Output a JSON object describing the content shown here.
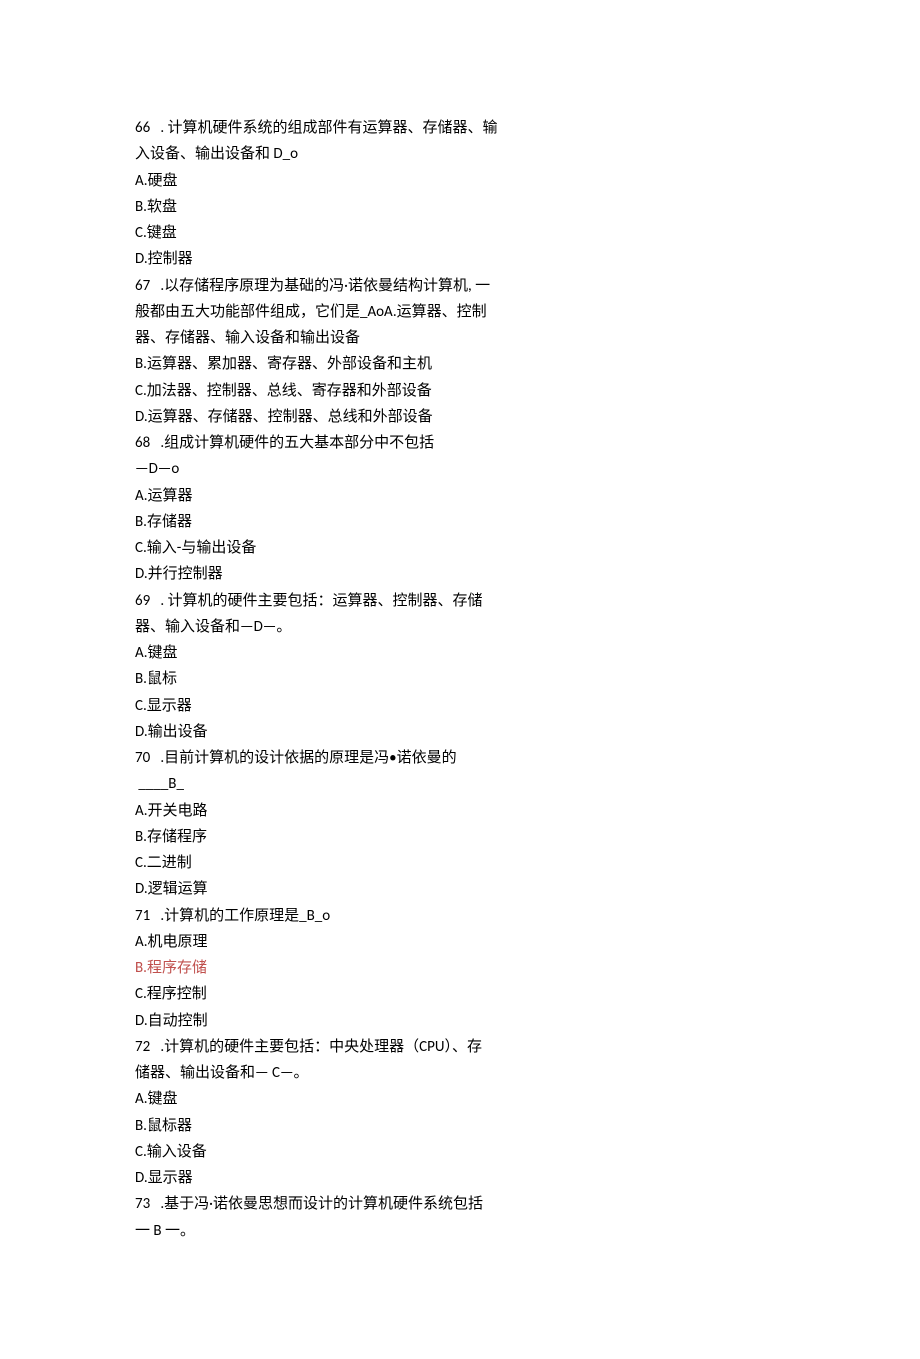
{
  "lines": [
    {
      "text": "66   . 计算机硬件系统的组成部件有运算器、存储器、输"
    },
    {
      "text": "入设备、输出设备和 D_o"
    },
    {
      "text": "A.硬盘"
    },
    {
      "text": "B.软盘"
    },
    {
      "text": "C.键盘"
    },
    {
      "text": "D.控制器"
    },
    {
      "text": "67   .以存储程序原理为基础的冯·诺依曼结构计算机, 一"
    },
    {
      "text": "般都由五大功能部件组成，它们是_AoA.运算器、控制"
    },
    {
      "text": "器、存储器、输入设备和输出设备"
    },
    {
      "text": "B.运算器、累加器、寄存器、外部设备和主机"
    },
    {
      "text": "C.加法器、控制器、总线、寄存器和外部设备"
    },
    {
      "text": "D.运算器、存储器、控制器、总线和外部设备"
    },
    {
      "text": "68   .组成计算机硬件的五大基本部分中不包括"
    },
    {
      "text": "—D—o"
    },
    {
      "text": "A.运算器"
    },
    {
      "text": "B.存储器"
    },
    {
      "text": "C.输入-与输出设备"
    },
    {
      "text": "D.并行控制器"
    },
    {
      "text": "69   . 计算机的硬件主要包括：运算器、控制器、存储"
    },
    {
      "text": "器、输入设备和—D—。"
    },
    {
      "text": "A.键盘"
    },
    {
      "text": "B.鼠标"
    },
    {
      "text": "C.显示器"
    },
    {
      "text": "D.输出设备"
    },
    {
      "text": "70   .目前计算机的设计依据的原理是冯•诺依曼的"
    },
    {
      "text": " ____B_"
    },
    {
      "text": "A.开关电路"
    },
    {
      "text": "B.存储程序"
    },
    {
      "text": "C.二进制"
    },
    {
      "text": "D.逻辑运算"
    },
    {
      "text": "71   .计算机的工作原理是_B_o"
    },
    {
      "text": "A.机电原理"
    },
    {
      "text": "B.程序存储",
      "highlight": true
    },
    {
      "text": "C.程序控制"
    },
    {
      "text": "D.自动控制"
    },
    {
      "text": "72   .计算机的硬件主要包括：中央处理器（CPU）、存"
    },
    {
      "text": "储器、输出设备和— C—。"
    },
    {
      "text": "A.键盘"
    },
    {
      "text": "B.鼠标器"
    },
    {
      "text": "C.输入设备"
    },
    {
      "text": "D.显示器"
    },
    {
      "text": "73   .基于冯·诺依曼思想而设计的计算机硬件系统包括"
    },
    {
      "text": "一 B 一。"
    }
  ]
}
